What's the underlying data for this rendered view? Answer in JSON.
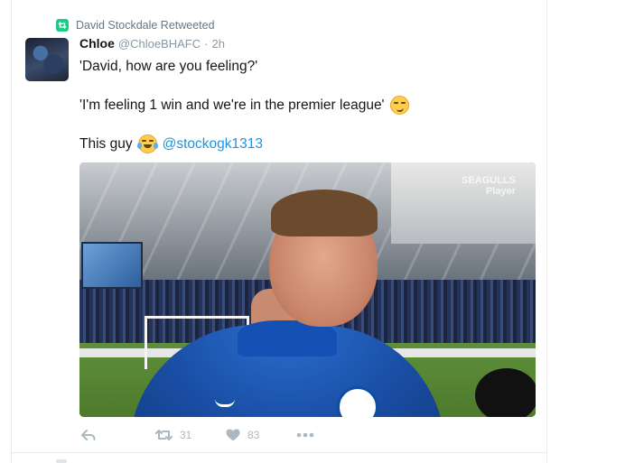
{
  "retweet_context": {
    "icon": "retweet-icon",
    "label": "David Stockdale Retweeted"
  },
  "tweet": {
    "author_name": "Chloe",
    "author_handle": "@ChloeBHAFC",
    "separator": "·",
    "time": "2h",
    "line1": "'David, how are you feeling?'",
    "line2": "'I'm feeling 1 win and we're in the premier league'",
    "line2_emoji": "smirk-face-emoji",
    "line3_prefix": "This guy",
    "line3_emoji": "tears-of-joy-emoji",
    "mention": "@stockogk1313"
  },
  "media": {
    "watermark_line1": "SEAGULLS",
    "watermark_line2": "Player"
  },
  "actions": {
    "retweet_count": "31",
    "like_count": "83"
  },
  "colors": {
    "retweet_green": "#19cf86",
    "mention_blue": "#1b95e0",
    "muted_gray": "#657786",
    "action_gray": "#aab8c2"
  }
}
